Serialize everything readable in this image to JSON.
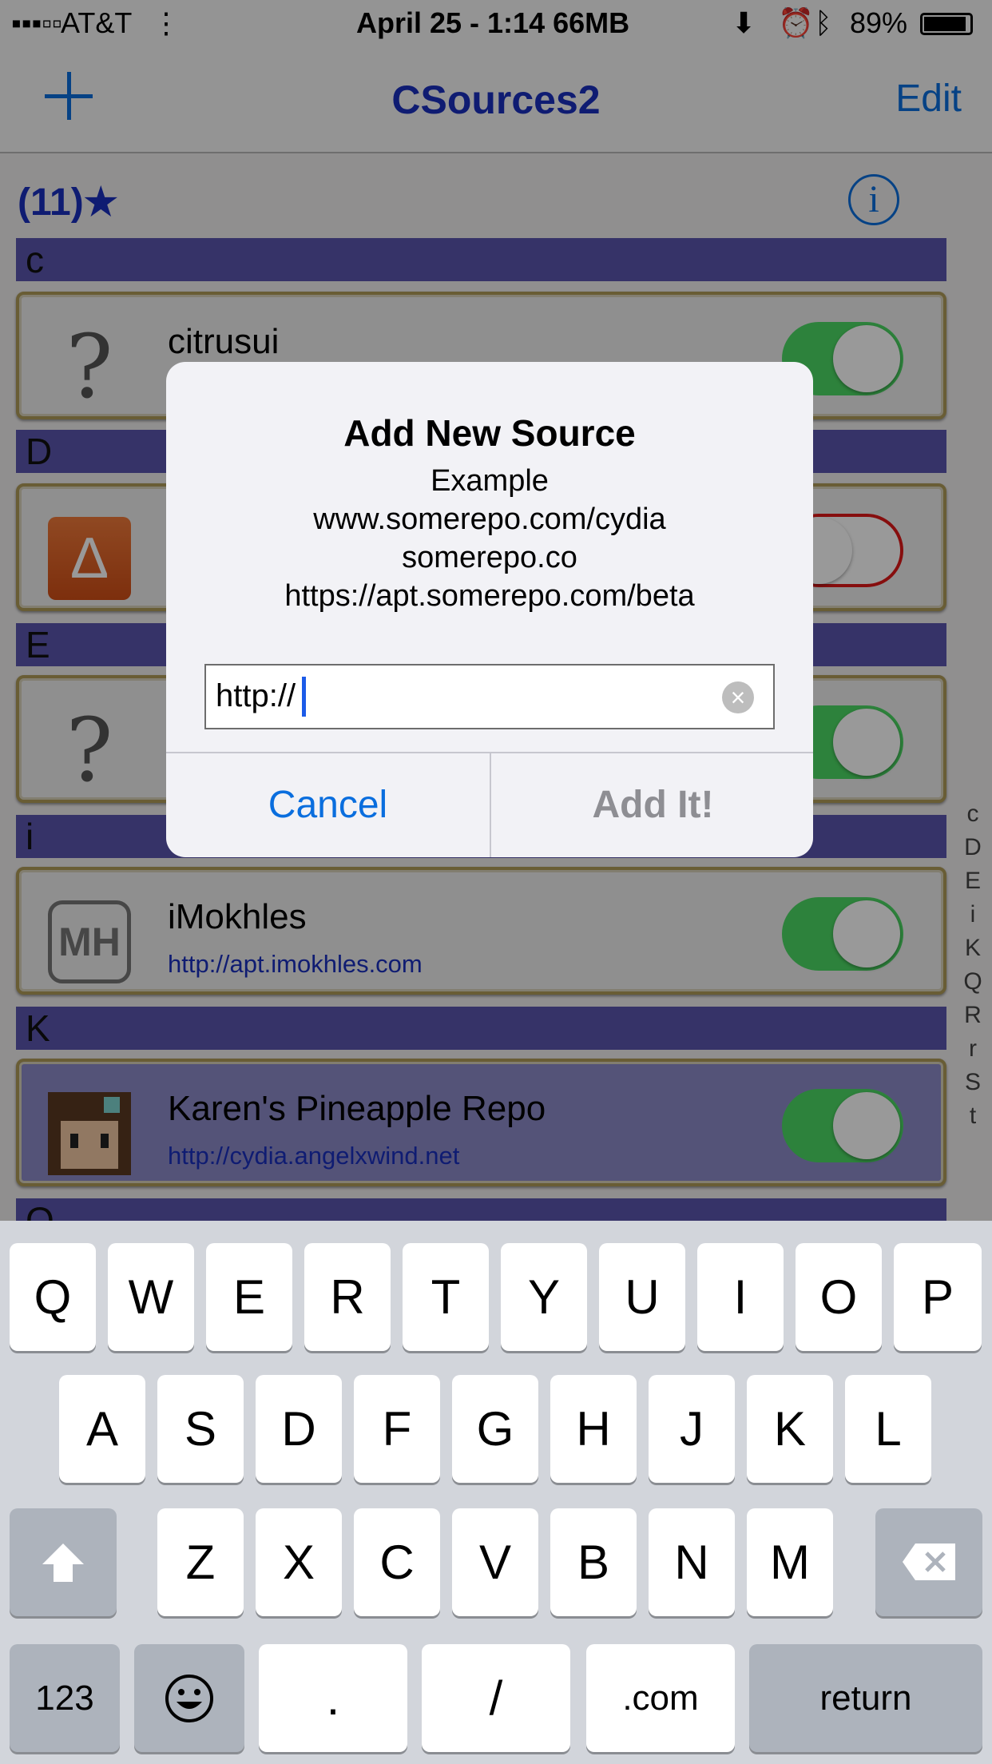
{
  "status_bar": {
    "carrier": "AT&T",
    "center": "April 25 - 1:14  66MB",
    "battery": "89%",
    "icons": [
      "signal-dots-icon",
      "download-icon",
      "alarm-icon",
      "bluetooth-icon",
      "battery-icon"
    ]
  },
  "nav": {
    "title": "CSources2",
    "edit_label": "Edit",
    "add_icon": "plus-icon"
  },
  "list": {
    "count": "(11)★",
    "info_icon": "info-icon",
    "index": [
      "c",
      "D",
      "E",
      "i",
      "K",
      "Q",
      "R",
      "r",
      "S",
      "t"
    ],
    "sections": [
      {
        "letter": "c",
        "rows": [
          {
            "name": "citrusui",
            "url": "",
            "icon": "question-mark-icon",
            "enabled": true
          }
        ]
      },
      {
        "letter": "D",
        "rows": [
          {
            "name": "",
            "url": "",
            "icon": "delta-icon",
            "enabled": false
          }
        ]
      },
      {
        "letter": "E",
        "rows": [
          {
            "name": "",
            "url": "",
            "icon": "question-mark-icon",
            "enabled": true
          }
        ]
      },
      {
        "letter": "i",
        "rows": [
          {
            "name": "iMokhles",
            "url": "http://apt.imokhles.com",
            "icon": "mh-logo-icon",
            "enabled": true
          }
        ]
      },
      {
        "letter": "K",
        "rows": [
          {
            "name": "Karen's Pineapple Repo",
            "url": "http://cydia.angelxwind.net",
            "icon": "pixel-avatar-icon",
            "enabled": true
          }
        ]
      },
      {
        "letter": "Q",
        "rows": []
      }
    ]
  },
  "alert": {
    "title": "Add New Source",
    "lines": [
      "Example",
      "www.somerepo.com/cydia",
      "somerepo.co",
      "https://apt.somerepo.com/beta"
    ],
    "field_value": "http://",
    "cancel_label": "Cancel",
    "confirm_label": "Add It!"
  },
  "keyboard": {
    "row1": [
      "Q",
      "W",
      "E",
      "R",
      "T",
      "Y",
      "U",
      "I",
      "O",
      "P"
    ],
    "row2": [
      "A",
      "S",
      "D",
      "F",
      "G",
      "H",
      "J",
      "K",
      "L"
    ],
    "row3": [
      "Z",
      "X",
      "C",
      "V",
      "B",
      "N",
      "M"
    ],
    "numbers_label": "123",
    "dot_label": ".",
    "slash_label": "/",
    "dotcom_label": ".com",
    "return_label": "return"
  },
  "colors": {
    "accent": "#0a6ede",
    "title_blue": "#1a2fbf",
    "section_bar": "#5a56ad",
    "toggle_on": "#4cd964",
    "toggle_off_border": "#e01818"
  }
}
